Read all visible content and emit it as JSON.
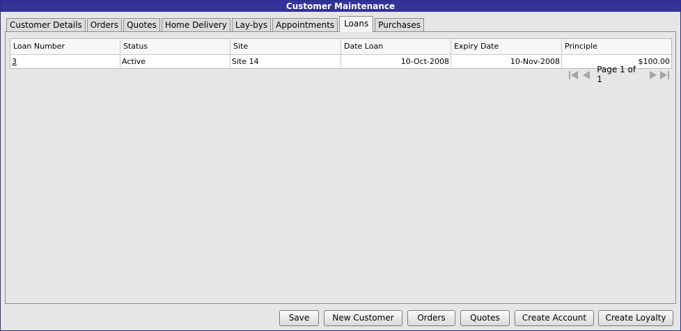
{
  "window": {
    "title": "Customer Maintenance"
  },
  "tabs": [
    {
      "label": "Customer Details",
      "active": false
    },
    {
      "label": "Orders",
      "active": false
    },
    {
      "label": "Quotes",
      "active": false
    },
    {
      "label": "Home Delivery",
      "active": false
    },
    {
      "label": "Lay-bys",
      "active": false
    },
    {
      "label": "Appointments",
      "active": false
    },
    {
      "label": "Loans",
      "active": true
    },
    {
      "label": "Purchases",
      "active": false
    }
  ],
  "loans_table": {
    "columns": [
      "Loan Number",
      "Status",
      "Site",
      "Date Loan",
      "Expiry Date",
      "Principle"
    ],
    "rows": [
      {
        "loan_number": "3",
        "status": "Active",
        "site": "Site 14",
        "date_loan": "10-Oct-2008",
        "expiry_date": "10-Nov-2008",
        "principle": "$100.00"
      }
    ]
  },
  "pager": {
    "label": "Page 1 of 1",
    "icons": [
      "first-page-icon",
      "previous-page-icon",
      "next-page-icon",
      "last-page-icon"
    ]
  },
  "buttons": {
    "save": "Save",
    "new_customer": "New Customer",
    "orders": "Orders",
    "quotes": "Quotes",
    "create_account": "Create Account",
    "create_loyalty": "Create Loyalty"
  },
  "colors": {
    "titlebar": "#33339a",
    "background": "#e6e6e6"
  }
}
